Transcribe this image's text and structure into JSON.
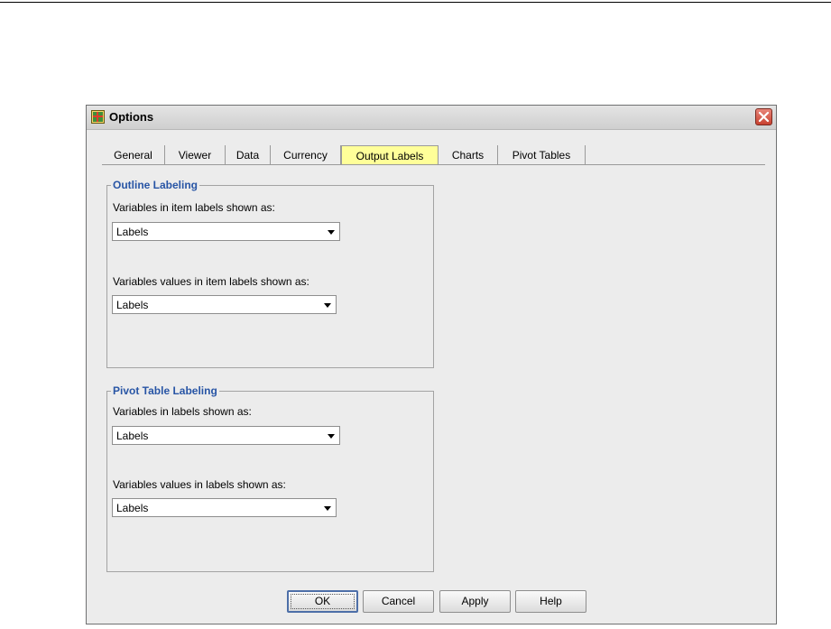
{
  "window": {
    "title": "Options"
  },
  "tabs": [
    {
      "label": "General"
    },
    {
      "label": "Viewer"
    },
    {
      "label": "Data"
    },
    {
      "label": "Currency"
    },
    {
      "label": "Output Labels",
      "active": true
    },
    {
      "label": "Charts"
    },
    {
      "label": "Pivot Tables"
    }
  ],
  "outline_labeling": {
    "title": "Outline Labeling",
    "variables_label": "Variables in item labels shown as:",
    "variables_value": "Labels",
    "values_label": "Variables values in item labels shown as:",
    "values_value": "Labels"
  },
  "pivot_labeling": {
    "title": "Pivot Table Labeling",
    "variables_label": "Variables in labels shown as:",
    "variables_value": "Labels",
    "values_label": "Variables values in labels shown as:",
    "values_value": "Labels"
  },
  "buttons": {
    "ok": "OK",
    "cancel": "Cancel",
    "apply": "Apply",
    "help": "Help"
  },
  "colors": {
    "active_tab": "#ffff99",
    "group_title": "#2855a5",
    "close_button": "#c8412f"
  },
  "icons": {
    "app": "options-app-icon",
    "close": "close-icon",
    "dropdown": "chevron-down-icon"
  }
}
